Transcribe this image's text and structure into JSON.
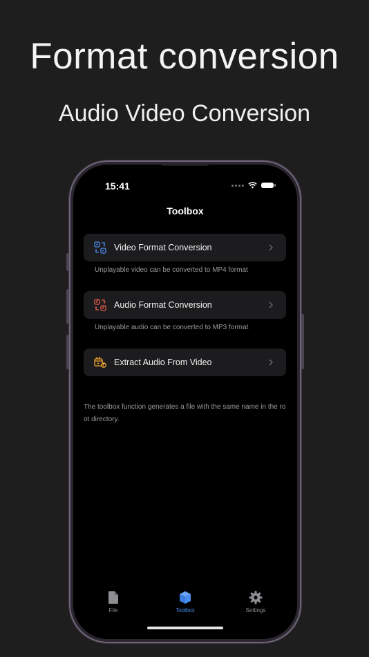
{
  "promo": {
    "headline": "Format conversion",
    "subheadline": "Audio Video Conversion"
  },
  "status_bar": {
    "time": "15:41"
  },
  "nav": {
    "title": "Toolbox"
  },
  "tools": [
    {
      "label": "Video Format Conversion",
      "caption": "Unplayable video can be converted to MP4 format",
      "icon": "video-convert-icon",
      "color": "#4a8df0"
    },
    {
      "label": "Audio Format Conversion",
      "caption": "Unplayable audio can be converted to MP3 format",
      "icon": "audio-convert-icon",
      "color": "#e05a4a"
    },
    {
      "label": "Extract Audio From Video",
      "caption": "",
      "icon": "extract-audio-icon",
      "color": "#f0a531"
    }
  ],
  "footer_note": "The toolbox function generates a file with the same name in the root directory.",
  "tabbar": {
    "tabs": [
      {
        "label": "File",
        "icon": "file-icon",
        "active": false
      },
      {
        "label": "Toolbox",
        "icon": "toolbox-cube-icon",
        "active": true
      },
      {
        "label": "Settings",
        "icon": "gear-icon",
        "active": false
      }
    ],
    "active_color": "#4a8df0",
    "inactive_color": "#8e8e93"
  }
}
